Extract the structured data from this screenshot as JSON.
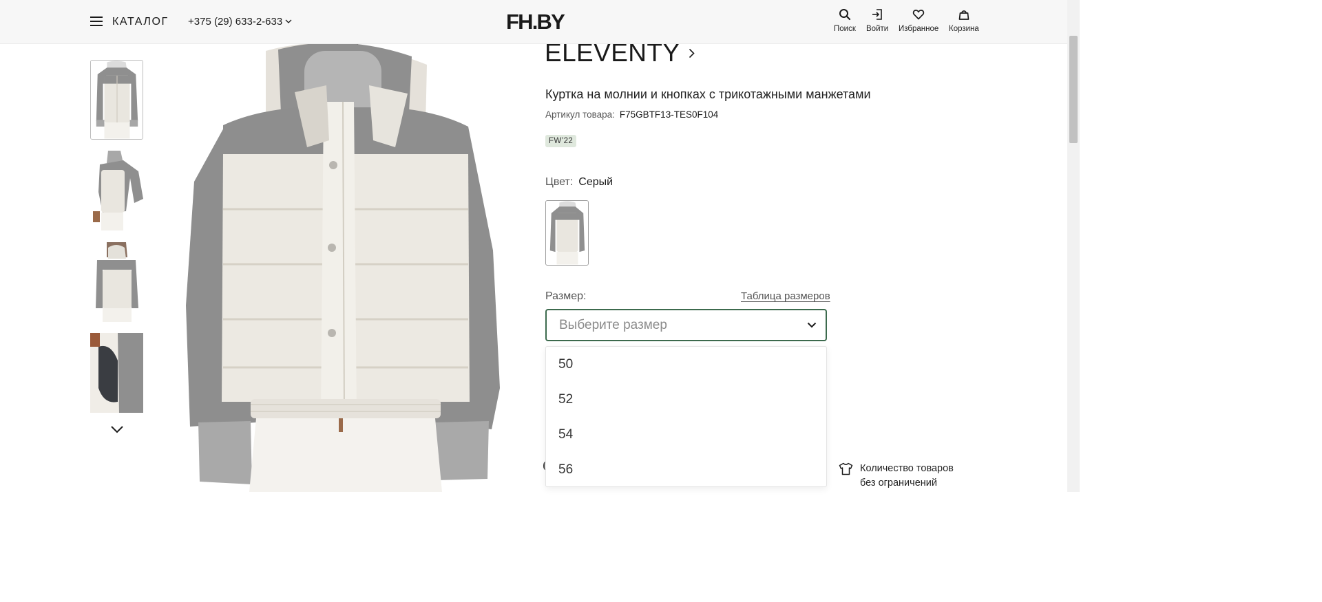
{
  "header": {
    "catalog_label": "КАТАЛОГ",
    "phone": "+375 (29) 633-2-633",
    "logo": "FH.BY",
    "nav": [
      {
        "label": "Поиск",
        "icon": "search-icon"
      },
      {
        "label": "Войти",
        "icon": "login-icon"
      },
      {
        "label": "Избранное",
        "icon": "heart-icon"
      },
      {
        "label": "Корзина",
        "icon": "bag-icon"
      }
    ]
  },
  "product": {
    "brand": "ELEVENTY",
    "title": "Куртка на молнии и кнопках с трикотажными манжетами",
    "sku_label": "Артикул товара:",
    "sku_value": "F75GBTF13-TES0F104",
    "season": "FW’22",
    "color_label": "Цвет:",
    "color_value": "Серый",
    "size_label": "Размер:",
    "size_table_link": "Таблица размеров",
    "size_placeholder": "Выберите размер",
    "size_options": [
      "50",
      "52",
      "54",
      "56"
    ],
    "qty_note_line1": "Количество товаров",
    "qty_note_line2": "без ограничений"
  },
  "colors": {
    "accent_green": "#3c6a4d",
    "season_badge_bg": "#dfe8dd",
    "header_bg": "#f7f7f7"
  }
}
